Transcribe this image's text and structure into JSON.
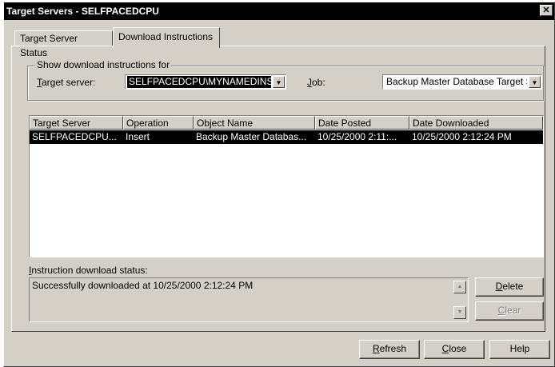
{
  "window": {
    "title": "Target Servers - SELFPACEDCPU",
    "close_glyph": "✕"
  },
  "tabs": [
    {
      "label": "Target Server Status"
    },
    {
      "label": "Download Instructions"
    }
  ],
  "group": {
    "legend": "Show download instructions for",
    "target_server_label_mn": "T",
    "target_server_label_rest": "arget server:",
    "target_server_value": "SELFPACEDCPU\\MYNAMEDINSTANCE",
    "job_label_mn": "J",
    "job_label_rest": "ob:",
    "job_value": "Backup Master Database Target Servers"
  },
  "table": {
    "columns": [
      "Target Server",
      "Operation",
      "Object Name",
      "Date Posted",
      "Date Downloaded"
    ],
    "rows": [
      [
        "SELFPACEDCPU...",
        "Insert",
        "Backup Master Databas...",
        "10/25/2000 2:11:...",
        "10/25/2000 2:12:24 PM"
      ]
    ]
  },
  "status": {
    "label_mn": "I",
    "label_rest": "nstruction download status:",
    "text": "Successfully downloaded at 10/25/2000 2:12:24 PM",
    "scroll_up": "▲",
    "scroll_down": "▼"
  },
  "buttons": {
    "delete_mn": "D",
    "delete_rest": "elete",
    "clear_mn": "C",
    "clear_rest": "lear",
    "refresh_mn": "R",
    "refresh_rest": "efresh",
    "close_mn": "C",
    "close_rest": "lose",
    "help": "Help"
  },
  "icons": {
    "dropdown": "▼"
  }
}
